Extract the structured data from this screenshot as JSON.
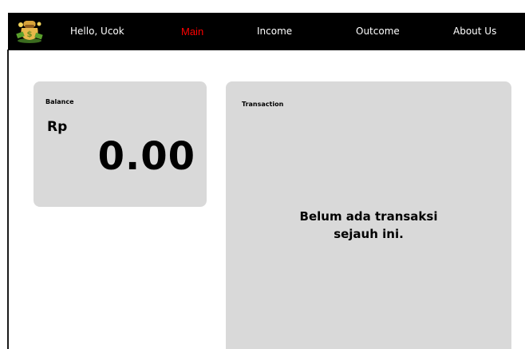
{
  "navbar": {
    "logo_icon": "money-bag-icon",
    "greeting": "Hello, Ucok",
    "items": [
      {
        "label": "Main",
        "active": true,
        "color": "#ff0000"
      },
      {
        "label": "Income",
        "active": false
      },
      {
        "label": "Outcome",
        "active": false
      },
      {
        "label": "About Us",
        "active": false
      }
    ]
  },
  "balance": {
    "label": "Balance",
    "currency": "Rp",
    "amount": "0.00"
  },
  "transaction": {
    "label": "Transaction",
    "empty_line1": "Belum ada transaksi",
    "empty_line2": "sejauh ini."
  },
  "colors": {
    "navbar_bg": "#000000",
    "card_bg": "#d9d9d9",
    "active_nav": "#ff0000"
  }
}
